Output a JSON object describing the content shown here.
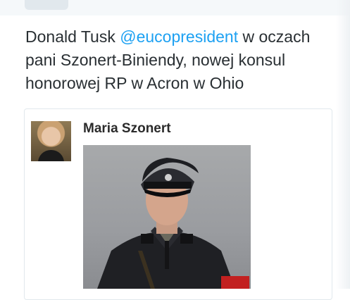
{
  "tweet": {
    "text_before": "Donald Tusk ",
    "mention": "@eucopresident",
    "text_after": " w oczach pani Szonert-Biniendy, nowej konsul honorowej RP w Acron w Ohio"
  },
  "embedded_post": {
    "author_name": "Maria Szonert",
    "avatar": "profile-photo",
    "image": "uniformed-portrait-photo"
  },
  "colors": {
    "mention": "#1da1f2",
    "text": "#292f33"
  }
}
